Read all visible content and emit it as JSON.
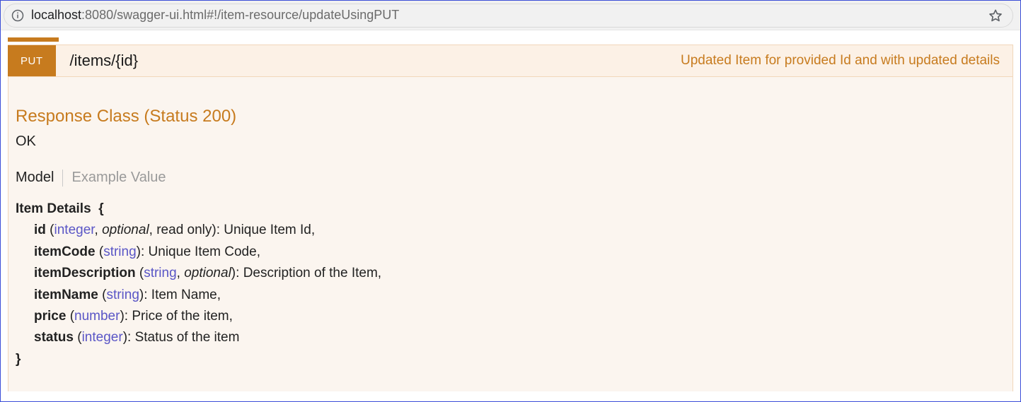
{
  "browser": {
    "url_prefix": "localhost",
    "url_rest": ":8080/swagger-ui.html#!/item-resource/updateUsingPUT"
  },
  "operation": {
    "method": "PUT",
    "path": "/items/{id}",
    "summary": "Updated Item for provided Id and with updated details"
  },
  "response": {
    "heading": "Response Class (Status 200)",
    "status_text": "OK"
  },
  "tabs": {
    "model": "Model",
    "example": "Example Value"
  },
  "model": {
    "title": "Item Details",
    "open_brace": "{",
    "close_brace": "}",
    "props": {
      "id": {
        "name": "id",
        "type": "integer",
        "optional_word": "optional",
        "readonly_text": "read only",
        "desc": "Unique Item Id"
      },
      "itemCode": {
        "name": "itemCode",
        "type": "string",
        "desc": "Unique Item Code"
      },
      "itemDescription": {
        "name": "itemDescription",
        "type": "string",
        "optional_word": "optional",
        "desc": "Description of the Item"
      },
      "itemName": {
        "name": "itemName",
        "type": "string",
        "desc": "Item Name"
      },
      "price": {
        "name": "price",
        "type": "number",
        "desc": "Price of the item"
      },
      "status": {
        "name": "status",
        "type": "integer",
        "desc": "Status of the item"
      }
    }
  }
}
